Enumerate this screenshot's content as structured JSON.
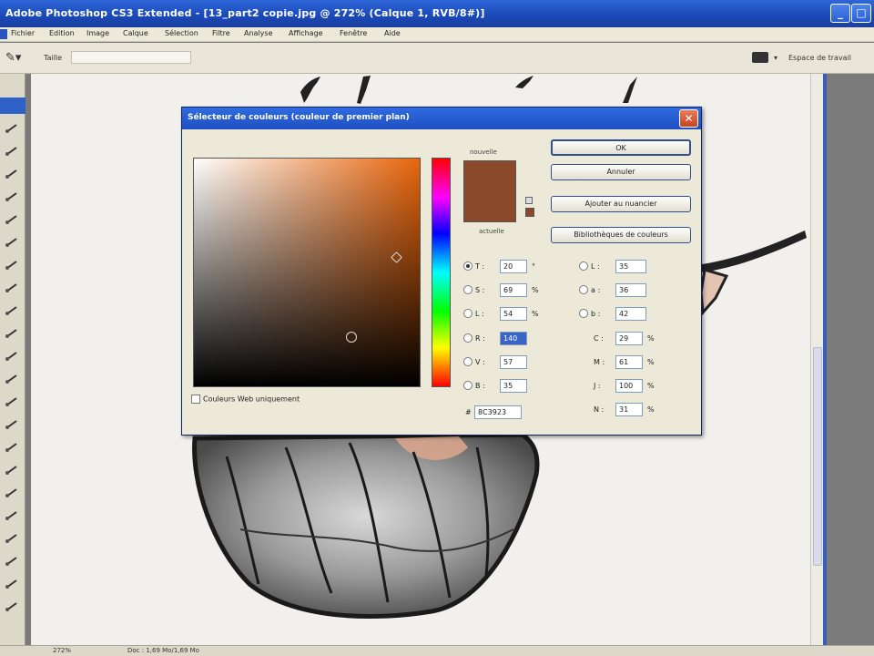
{
  "titlebar": {
    "title": "Adobe Photoshop CS3 Extended - [13_part2 copie.jpg @ 272% (Calque 1, RVB/8#)]",
    "minimize": "_",
    "maximize": "□",
    "close": "✕"
  },
  "menu": [
    "Fichier",
    "Edition",
    "Image",
    "Calque",
    "Sélection",
    "Filtre",
    "Analyse",
    "Affichage",
    "Fenêtre",
    "Aide"
  ],
  "options": {
    "label": "Taille",
    "workspace": "Espace de travail",
    "workspace_arrow": "▾"
  },
  "dialog": {
    "title": "Sélecteur de couleurs (couleur de premier plan)",
    "close": "✕",
    "new_label": "nouvelle",
    "current_label": "actuelle",
    "ok": "OK",
    "cancel": "Annuler",
    "add_swatch": "Ajouter au nuancier",
    "libraries": "Bibliothèques de couleurs",
    "web_only": "Couleurs Web uniquement",
    "color_hex": "#8a4a2a",
    "fields": {
      "T": {
        "label": "T :",
        "value": "20",
        "unit": "°"
      },
      "S": {
        "label": "S :",
        "value": "69",
        "unit": "%"
      },
      "L": {
        "label": "L :",
        "value": "54",
        "unit": "%"
      },
      "R": {
        "label": "R :",
        "value": "140",
        "unit": ""
      },
      "V": {
        "label": "V :",
        "value": "57",
        "unit": ""
      },
      "B": {
        "label": "B :",
        "value": "35",
        "unit": ""
      },
      "Lab_L": {
        "label": "L :",
        "value": "35",
        "unit": ""
      },
      "Lab_a": {
        "label": "a :",
        "value": "36",
        "unit": ""
      },
      "Lab_b": {
        "label": "b :",
        "value": "42",
        "unit": ""
      },
      "C": {
        "label": "C :",
        "value": "29",
        "unit": "%"
      },
      "M": {
        "label": "M :",
        "value": "61",
        "unit": "%"
      },
      "J": {
        "label": "J :",
        "value": "100",
        "unit": "%"
      },
      "N": {
        "label": "N :",
        "value": "31",
        "unit": "%"
      },
      "hex": {
        "label": "#",
        "value": "8C3923"
      }
    }
  },
  "status": {
    "zoom": "272%",
    "doc": "Doc : 1,69 Mo/1,69 Mo"
  },
  "colors": {
    "foreground": "#8a3f1c",
    "background": "#2a8a2a"
  }
}
